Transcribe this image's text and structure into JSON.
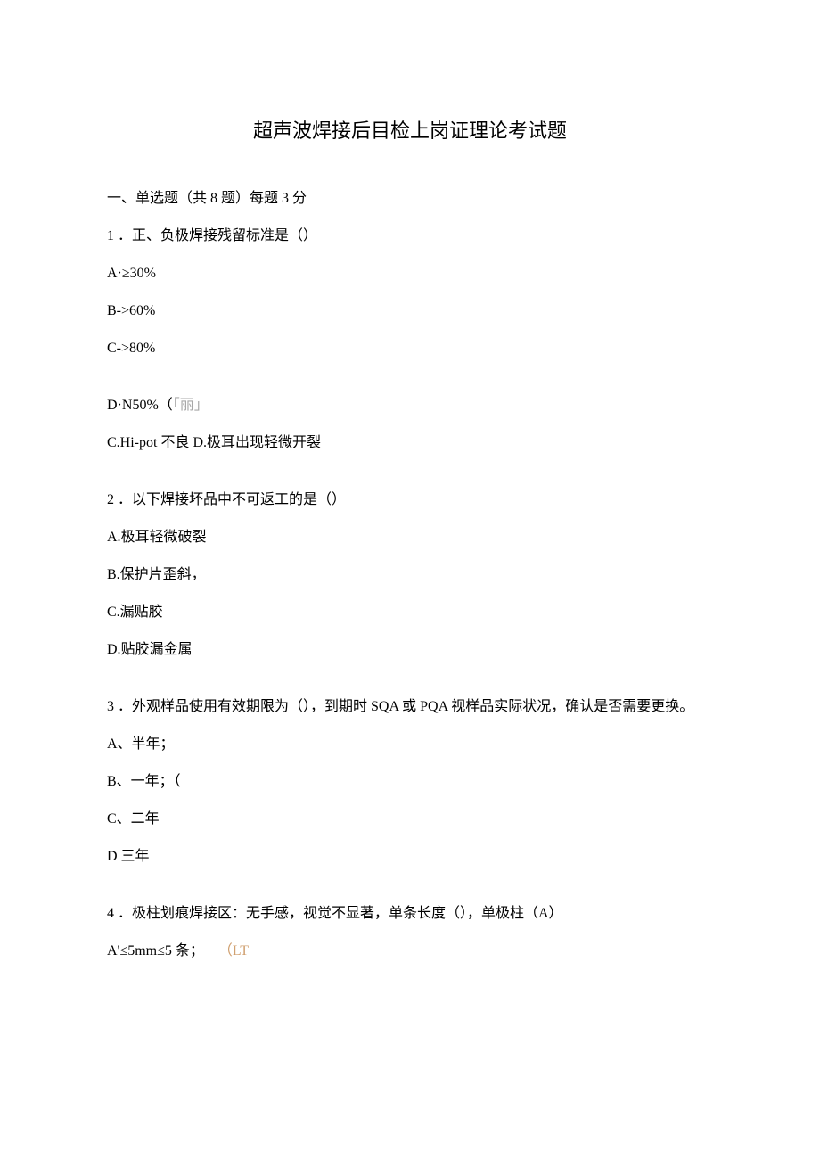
{
  "title": "超声波焊接后目检上岗证理论考试题",
  "section_heading": "一、单选题（共 8 题）每题 3 分",
  "q1": {
    "stem": "1 ．正、负极焊接残留标准是（）",
    "a": "A·≥30%",
    "b": "B->60%",
    "c": "C->80%",
    "d_prefix": "D·N50%（",
    "d_bracket": "「丽」",
    "extra": "C.Hi-pot 不良 D.极耳出现轻微开裂"
  },
  "q2": {
    "stem": "2 ．以下焊接坏品中不可返工的是（）",
    "a": "A.极耳轻微破裂",
    "b": "B.保护片歪斜，",
    "c": "C.漏贴胶",
    "d": "D.贴胶漏金属"
  },
  "q3": {
    "stem": "3 ．外观样品使用有效期限为（），到期时 SQA 或 PQA 视样品实际状况，确认是否需要更换。",
    "a": "A、半年；",
    "b": "B、一年；（",
    "c": "C、二年",
    "d": "D 三年"
  },
  "q4": {
    "stem": "4 ．极柱划痕焊接区：无手感，视觉不显著，单条长度（），单极柱（A）",
    "a_prefix": "A'≤5mm≤5 条；",
    "a_suffix": "（LT"
  }
}
